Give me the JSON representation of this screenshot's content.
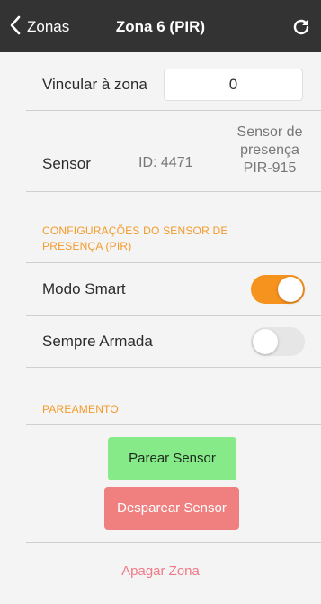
{
  "navbar": {
    "back_label": "Zonas",
    "title": "Zona 6 (PIR)",
    "back_icon": "chevron-left-icon",
    "refresh_icon": "refresh-icon"
  },
  "link_zone": {
    "label": "Vincular à zona",
    "value": "0"
  },
  "sensor": {
    "label": "Sensor",
    "id": "ID: 4471",
    "description_lines": [
      "Sensor de",
      "presença",
      "PIR-915"
    ]
  },
  "pir_section": {
    "header_line1": "CONFIGURAÇÕES DO SENSOR DE",
    "header_line2": "PRESENÇA (PIR)",
    "smart_mode_label": "Modo Smart",
    "smart_mode_on": true,
    "always_armed_label": "Sempre Armada",
    "always_armed_on": false
  },
  "pairing_section": {
    "header": "PAREAMENTO",
    "pair_button": "Parear Sensor",
    "unpair_button": "Desparear Sensor"
  },
  "delete_zone": "Apagar Zona",
  "colors": {
    "navbar": "#333333",
    "accent_orange": "#f6921e",
    "section_header": "#f39a2a",
    "pair_green": "#86ea88",
    "unpair_red": "#f08080",
    "delete_pink": "#f07a88"
  }
}
